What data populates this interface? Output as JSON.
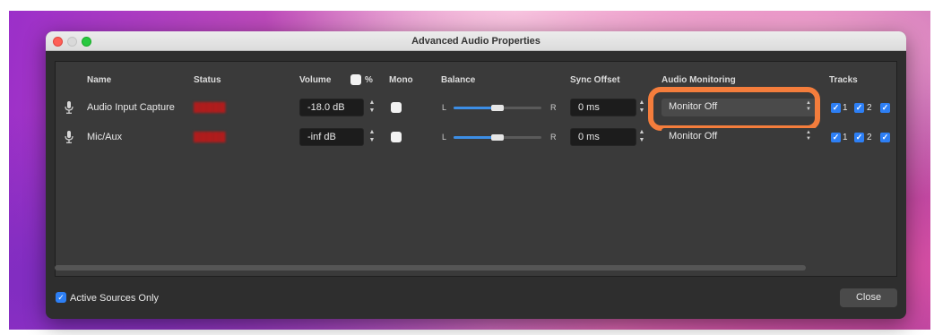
{
  "window": {
    "title": "Advanced Audio Properties"
  },
  "headers": {
    "name": "Name",
    "status": "Status",
    "volume": "Volume",
    "percent": "%",
    "mono": "Mono",
    "balance": "Balance",
    "sync_offset": "Sync Offset",
    "audio_monitoring": "Audio Monitoring",
    "tracks": "Tracks"
  },
  "rows": [
    {
      "name": "Audio Input Capture",
      "volume": "-18.0 dB",
      "mono": false,
      "balance_left": "L",
      "balance_right": "R",
      "balance_level": 0.5,
      "sync_offset": "0 ms",
      "monitoring": "Monitor Off",
      "tracks": [
        "1",
        "2"
      ]
    },
    {
      "name": "Mic/Aux",
      "volume": "-inf dB",
      "mono": false,
      "balance_left": "L",
      "balance_right": "R",
      "balance_level": 0.5,
      "sync_offset": "0 ms",
      "monitoring": "Monitor Off",
      "tracks": [
        "1",
        "2"
      ]
    }
  ],
  "footer": {
    "active_sources_only": "Active Sources Only",
    "active_sources_checked": true,
    "close_button": "Close"
  },
  "colors": {
    "accent": "#2d7ff5",
    "highlight": "#f47d3c",
    "status_text": "#b01c1c"
  },
  "icons": [
    "microphone-icon",
    "checkbox-icon",
    "spinner-arrows-icon",
    "select-arrows-icon"
  ]
}
